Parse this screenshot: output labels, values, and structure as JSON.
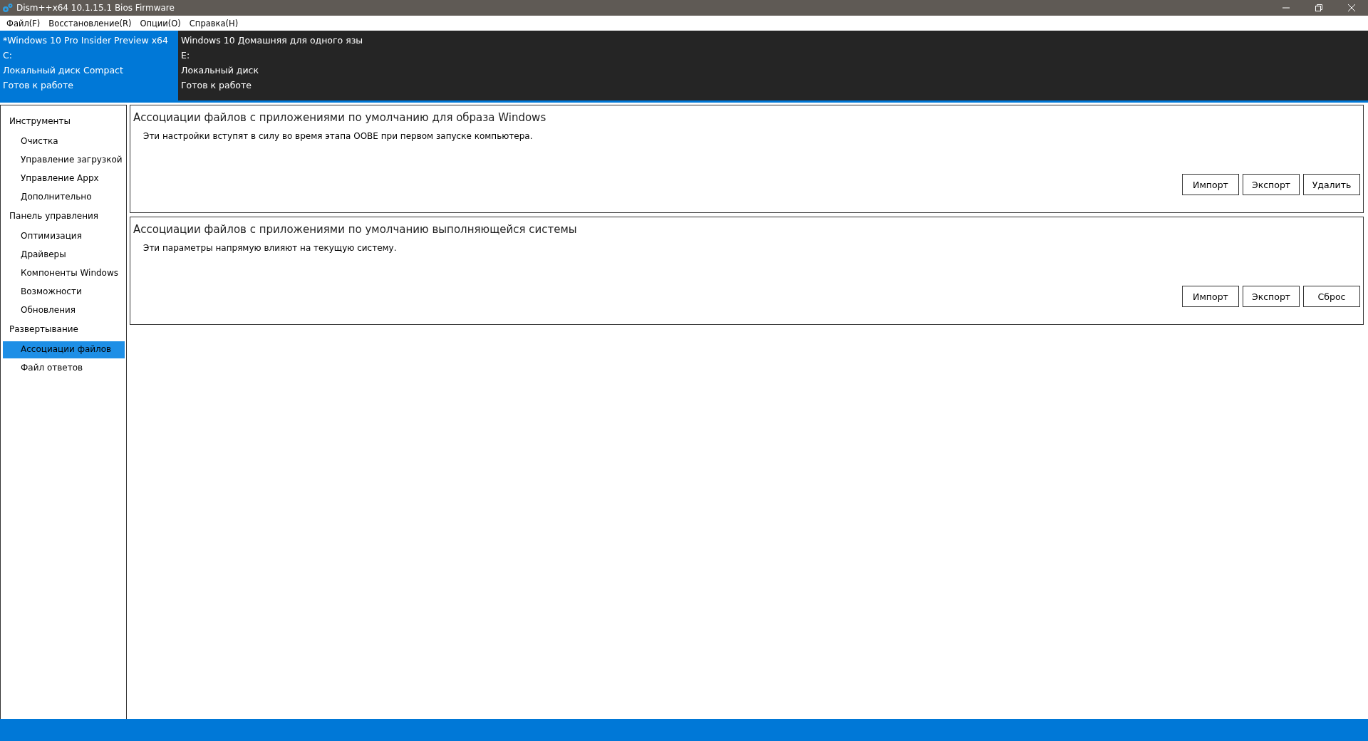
{
  "window": {
    "title": "Dism++x64 10.1.15.1 Bios Firmware"
  },
  "menu": [
    "Файл(F)",
    "Восстановление(R)",
    "Опции(O)",
    "Справка(H)"
  ],
  "images": [
    {
      "lines": [
        "*Windows 10 Pro Insider Preview x64",
        "C:",
        "Локальный диск Compact",
        "Готов к работе"
      ],
      "selected": true
    },
    {
      "lines": [
        "Windows 10 Домашняя для одного язы",
        "E:",
        "Локальный диск",
        "Готов к работе"
      ],
      "selected": false
    }
  ],
  "sidebar": [
    {
      "label": "Инструменты",
      "children": [
        {
          "label": "Очистка",
          "selected": false
        },
        {
          "label": "Управление загрузкой",
          "selected": false
        },
        {
          "label": "Управление Appx",
          "selected": false
        },
        {
          "label": "Дополнительно",
          "selected": false
        }
      ]
    },
    {
      "label": "Панель управления",
      "children": [
        {
          "label": "Оптимизация",
          "selected": false
        },
        {
          "label": "Драйверы",
          "selected": false
        },
        {
          "label": "Компоненты Windows",
          "selected": false
        },
        {
          "label": "Возможности",
          "selected": false
        },
        {
          "label": "Обновления",
          "selected": false
        }
      ]
    },
    {
      "label": "Развертывание",
      "children": [
        {
          "label": "Ассоциации файлов",
          "selected": true
        },
        {
          "label": "Файл ответов",
          "selected": false
        }
      ]
    }
  ],
  "panels": [
    {
      "title": "Ассоциации файлов с приложениями по умолчанию для образа Windows",
      "description": "Эти настройки вступят в силу во время этапа OOBE при первом запуске компьютера.",
      "buttons": [
        "Импорт",
        "Экспорт",
        "Удалить"
      ]
    },
    {
      "title": "Ассоциации файлов с приложениями по умолчанию выполняющейся системы",
      "description": "Эти параметры напрямую влияют на текущую систему.",
      "buttons": [
        "Импорт",
        "Экспорт",
        "Сброс"
      ]
    }
  ]
}
